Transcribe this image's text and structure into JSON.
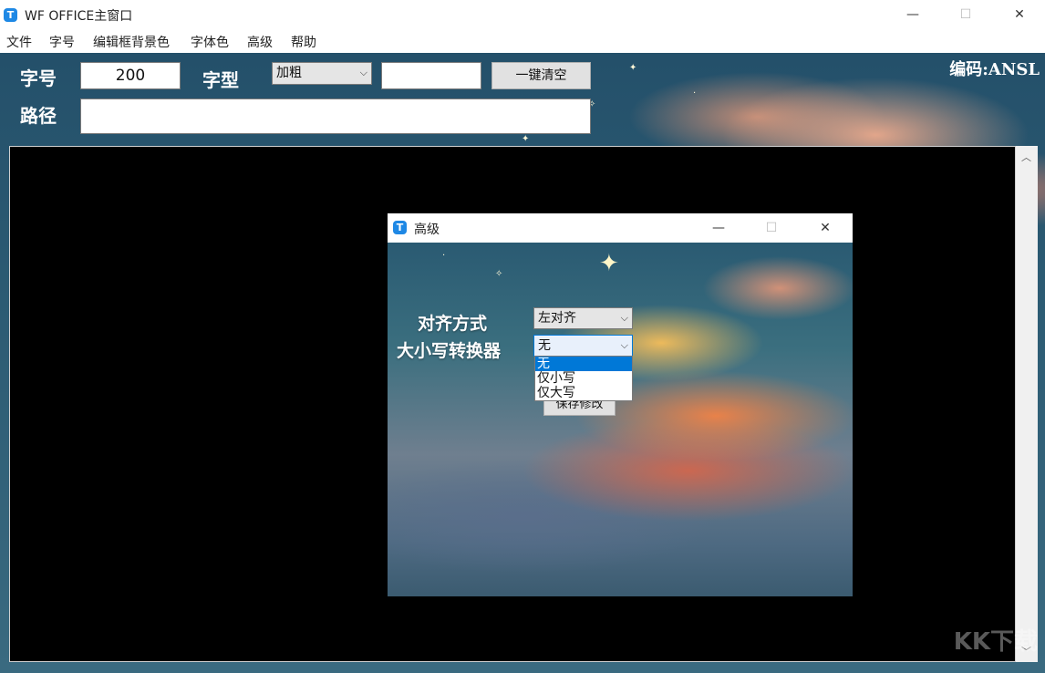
{
  "window": {
    "title": "WF OFFICE主窗口",
    "icon_letter": "T",
    "minimize": "—",
    "maximize": "☐",
    "close": "✕"
  },
  "menu": [
    "文件",
    "字号",
    "编辑框背景色",
    "字体色",
    "高级",
    "帮助"
  ],
  "toolbar": {
    "font_size_label": "字号",
    "font_size_value": "200",
    "font_style_label": "字型",
    "font_style_value": "加粗",
    "extra_input_value": "",
    "clear_button": "一键清空",
    "path_label": "路径",
    "path_value": "",
    "encoding_label": "编码:ANSL"
  },
  "dialog": {
    "title": "高级",
    "icon_letter": "T",
    "align_label": "对齐方式",
    "align_value": "左对齐",
    "case_label": "大小写转换器",
    "case_value": "无",
    "case_options": [
      "无",
      "仅小写",
      "仅大写"
    ],
    "case_selected_index": 0,
    "save_button": "保存修改"
  },
  "watermark": "KK下载",
  "colors": {
    "dialog_selected": "#0078d7",
    "canvas": "#000000"
  }
}
